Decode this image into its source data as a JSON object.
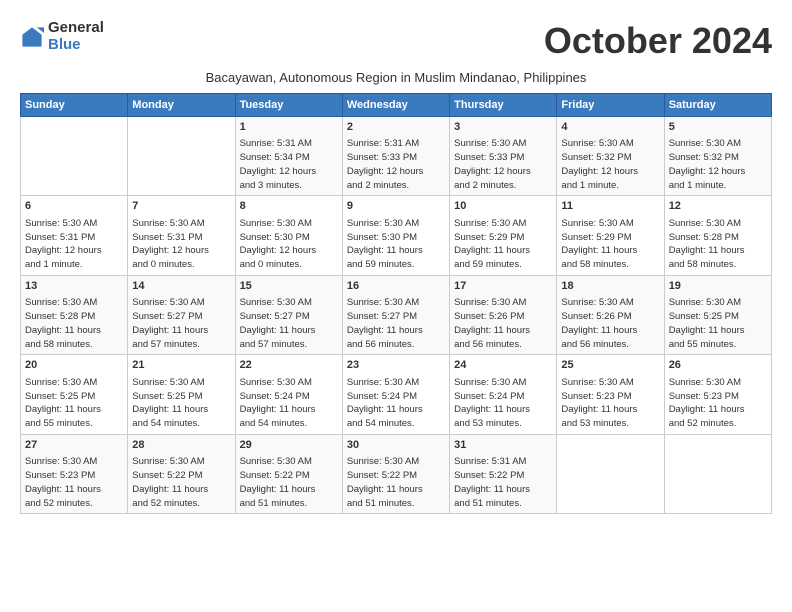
{
  "logo": {
    "general": "General",
    "blue": "Blue"
  },
  "title": "October 2024",
  "subtitle": "Bacayawan, Autonomous Region in Muslim Mindanao, Philippines",
  "headers": [
    "Sunday",
    "Monday",
    "Tuesday",
    "Wednesday",
    "Thursday",
    "Friday",
    "Saturday"
  ],
  "weeks": [
    [
      {
        "day": "",
        "info": ""
      },
      {
        "day": "",
        "info": ""
      },
      {
        "day": "1",
        "info": "Sunrise: 5:31 AM\nSunset: 5:34 PM\nDaylight: 12 hours\nand 3 minutes."
      },
      {
        "day": "2",
        "info": "Sunrise: 5:31 AM\nSunset: 5:33 PM\nDaylight: 12 hours\nand 2 minutes."
      },
      {
        "day": "3",
        "info": "Sunrise: 5:30 AM\nSunset: 5:33 PM\nDaylight: 12 hours\nand 2 minutes."
      },
      {
        "day": "4",
        "info": "Sunrise: 5:30 AM\nSunset: 5:32 PM\nDaylight: 12 hours\nand 1 minute."
      },
      {
        "day": "5",
        "info": "Sunrise: 5:30 AM\nSunset: 5:32 PM\nDaylight: 12 hours\nand 1 minute."
      }
    ],
    [
      {
        "day": "6",
        "info": "Sunrise: 5:30 AM\nSunset: 5:31 PM\nDaylight: 12 hours\nand 1 minute."
      },
      {
        "day": "7",
        "info": "Sunrise: 5:30 AM\nSunset: 5:31 PM\nDaylight: 12 hours\nand 0 minutes."
      },
      {
        "day": "8",
        "info": "Sunrise: 5:30 AM\nSunset: 5:30 PM\nDaylight: 12 hours\nand 0 minutes."
      },
      {
        "day": "9",
        "info": "Sunrise: 5:30 AM\nSunset: 5:30 PM\nDaylight: 11 hours\nand 59 minutes."
      },
      {
        "day": "10",
        "info": "Sunrise: 5:30 AM\nSunset: 5:29 PM\nDaylight: 11 hours\nand 59 minutes."
      },
      {
        "day": "11",
        "info": "Sunrise: 5:30 AM\nSunset: 5:29 PM\nDaylight: 11 hours\nand 58 minutes."
      },
      {
        "day": "12",
        "info": "Sunrise: 5:30 AM\nSunset: 5:28 PM\nDaylight: 11 hours\nand 58 minutes."
      }
    ],
    [
      {
        "day": "13",
        "info": "Sunrise: 5:30 AM\nSunset: 5:28 PM\nDaylight: 11 hours\nand 58 minutes."
      },
      {
        "day": "14",
        "info": "Sunrise: 5:30 AM\nSunset: 5:27 PM\nDaylight: 11 hours\nand 57 minutes."
      },
      {
        "day": "15",
        "info": "Sunrise: 5:30 AM\nSunset: 5:27 PM\nDaylight: 11 hours\nand 57 minutes."
      },
      {
        "day": "16",
        "info": "Sunrise: 5:30 AM\nSunset: 5:27 PM\nDaylight: 11 hours\nand 56 minutes."
      },
      {
        "day": "17",
        "info": "Sunrise: 5:30 AM\nSunset: 5:26 PM\nDaylight: 11 hours\nand 56 minutes."
      },
      {
        "day": "18",
        "info": "Sunrise: 5:30 AM\nSunset: 5:26 PM\nDaylight: 11 hours\nand 56 minutes."
      },
      {
        "day": "19",
        "info": "Sunrise: 5:30 AM\nSunset: 5:25 PM\nDaylight: 11 hours\nand 55 minutes."
      }
    ],
    [
      {
        "day": "20",
        "info": "Sunrise: 5:30 AM\nSunset: 5:25 PM\nDaylight: 11 hours\nand 55 minutes."
      },
      {
        "day": "21",
        "info": "Sunrise: 5:30 AM\nSunset: 5:25 PM\nDaylight: 11 hours\nand 54 minutes."
      },
      {
        "day": "22",
        "info": "Sunrise: 5:30 AM\nSunset: 5:24 PM\nDaylight: 11 hours\nand 54 minutes."
      },
      {
        "day": "23",
        "info": "Sunrise: 5:30 AM\nSunset: 5:24 PM\nDaylight: 11 hours\nand 54 minutes."
      },
      {
        "day": "24",
        "info": "Sunrise: 5:30 AM\nSunset: 5:24 PM\nDaylight: 11 hours\nand 53 minutes."
      },
      {
        "day": "25",
        "info": "Sunrise: 5:30 AM\nSunset: 5:23 PM\nDaylight: 11 hours\nand 53 minutes."
      },
      {
        "day": "26",
        "info": "Sunrise: 5:30 AM\nSunset: 5:23 PM\nDaylight: 11 hours\nand 52 minutes."
      }
    ],
    [
      {
        "day": "27",
        "info": "Sunrise: 5:30 AM\nSunset: 5:23 PM\nDaylight: 11 hours\nand 52 minutes."
      },
      {
        "day": "28",
        "info": "Sunrise: 5:30 AM\nSunset: 5:22 PM\nDaylight: 11 hours\nand 52 minutes."
      },
      {
        "day": "29",
        "info": "Sunrise: 5:30 AM\nSunset: 5:22 PM\nDaylight: 11 hours\nand 51 minutes."
      },
      {
        "day": "30",
        "info": "Sunrise: 5:30 AM\nSunset: 5:22 PM\nDaylight: 11 hours\nand 51 minutes."
      },
      {
        "day": "31",
        "info": "Sunrise: 5:31 AM\nSunset: 5:22 PM\nDaylight: 11 hours\nand 51 minutes."
      },
      {
        "day": "",
        "info": ""
      },
      {
        "day": "",
        "info": ""
      }
    ]
  ]
}
